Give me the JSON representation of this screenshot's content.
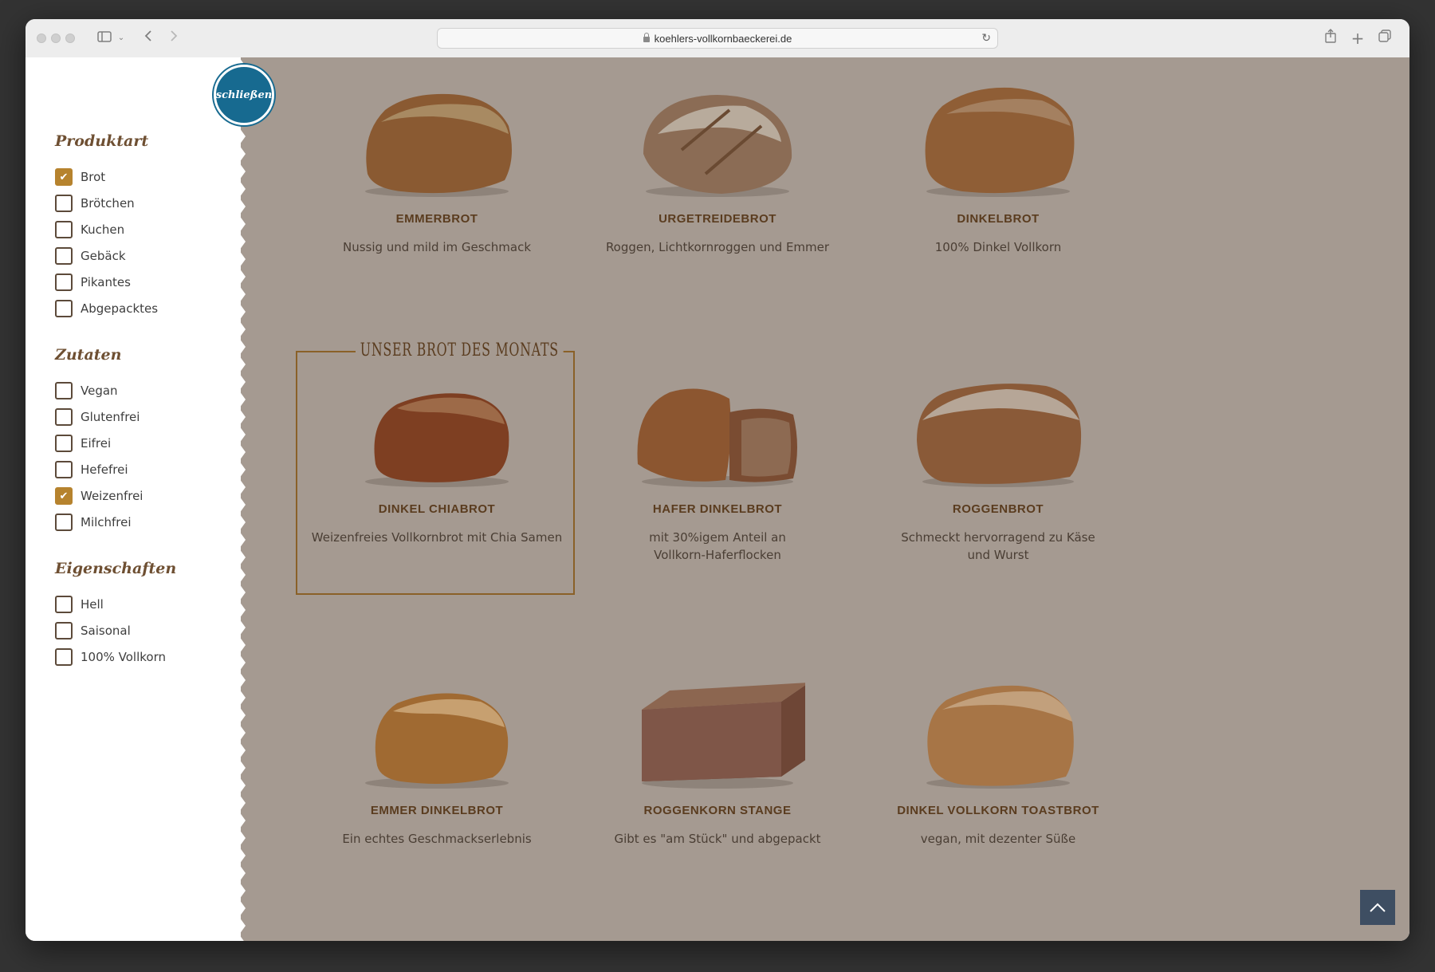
{
  "browser": {
    "url": "koehlers-vollkornbaeckerei.de"
  },
  "sidebar": {
    "close_label": "schließen",
    "groups": [
      {
        "title": "Produktart",
        "items": [
          {
            "label": "Brot",
            "checked": true
          },
          {
            "label": "Brötchen",
            "checked": false
          },
          {
            "label": "Kuchen",
            "checked": false
          },
          {
            "label": "Gebäck",
            "checked": false
          },
          {
            "label": "Pikantes",
            "checked": false
          },
          {
            "label": "Abgepacktes",
            "checked": false
          }
        ]
      },
      {
        "title": "Zutaten",
        "items": [
          {
            "label": "Vegan",
            "checked": false
          },
          {
            "label": "Glutenfrei",
            "checked": false
          },
          {
            "label": "Eifrei",
            "checked": false
          },
          {
            "label": "Hefefrei",
            "checked": false
          },
          {
            "label": "Weizenfrei",
            "checked": true
          },
          {
            "label": "Milchfrei",
            "checked": false
          }
        ]
      },
      {
        "title": "Eigenschaften",
        "items": [
          {
            "label": "Hell",
            "checked": false
          },
          {
            "label": "Saisonal",
            "checked": false
          },
          {
            "label": "100% Vollkorn",
            "checked": false
          }
        ]
      }
    ]
  },
  "featured_label": "UNSER BROT DES MONATS",
  "products": [
    {
      "name": "EMMERBROT",
      "desc": "Nussig und mild im Geschmack"
    },
    {
      "name": "URGETREIDEBROT",
      "desc": "Roggen, Lichtkornroggen und Emmer"
    },
    {
      "name": "DINKELBROT",
      "desc": "100% Dinkel Vollkorn"
    },
    {
      "name": "DINKEL CHIABROT",
      "desc": "Weizenfreies Vollkornbrot mit Chia Samen"
    },
    {
      "name": "HAFER DINKELBROT",
      "desc": "mit 30%igem Anteil an Vollkorn-Haferflocken"
    },
    {
      "name": "ROGGENBROT",
      "desc": "Schmeckt hervorragend zu Käse und Wurst"
    },
    {
      "name": "EMMER DINKELBROT",
      "desc": "Ein echtes Geschmackserlebnis"
    },
    {
      "name": "ROGGENKORN STANGE",
      "desc": "Gibt es \"am Stück\" und abgepackt"
    },
    {
      "name": "DINKEL VOLLKORN TOASTBROT",
      "desc": "vegan, mit dezenter Süße"
    }
  ],
  "colors": {
    "page_bg": "#a59a91",
    "accent_checkbox": "#b6832e",
    "close_badge": "#176a90",
    "heading_brown": "#6e4f32"
  },
  "icons": {
    "scroll_top": "chevron-up-icon",
    "close_badge": "close-badge"
  }
}
